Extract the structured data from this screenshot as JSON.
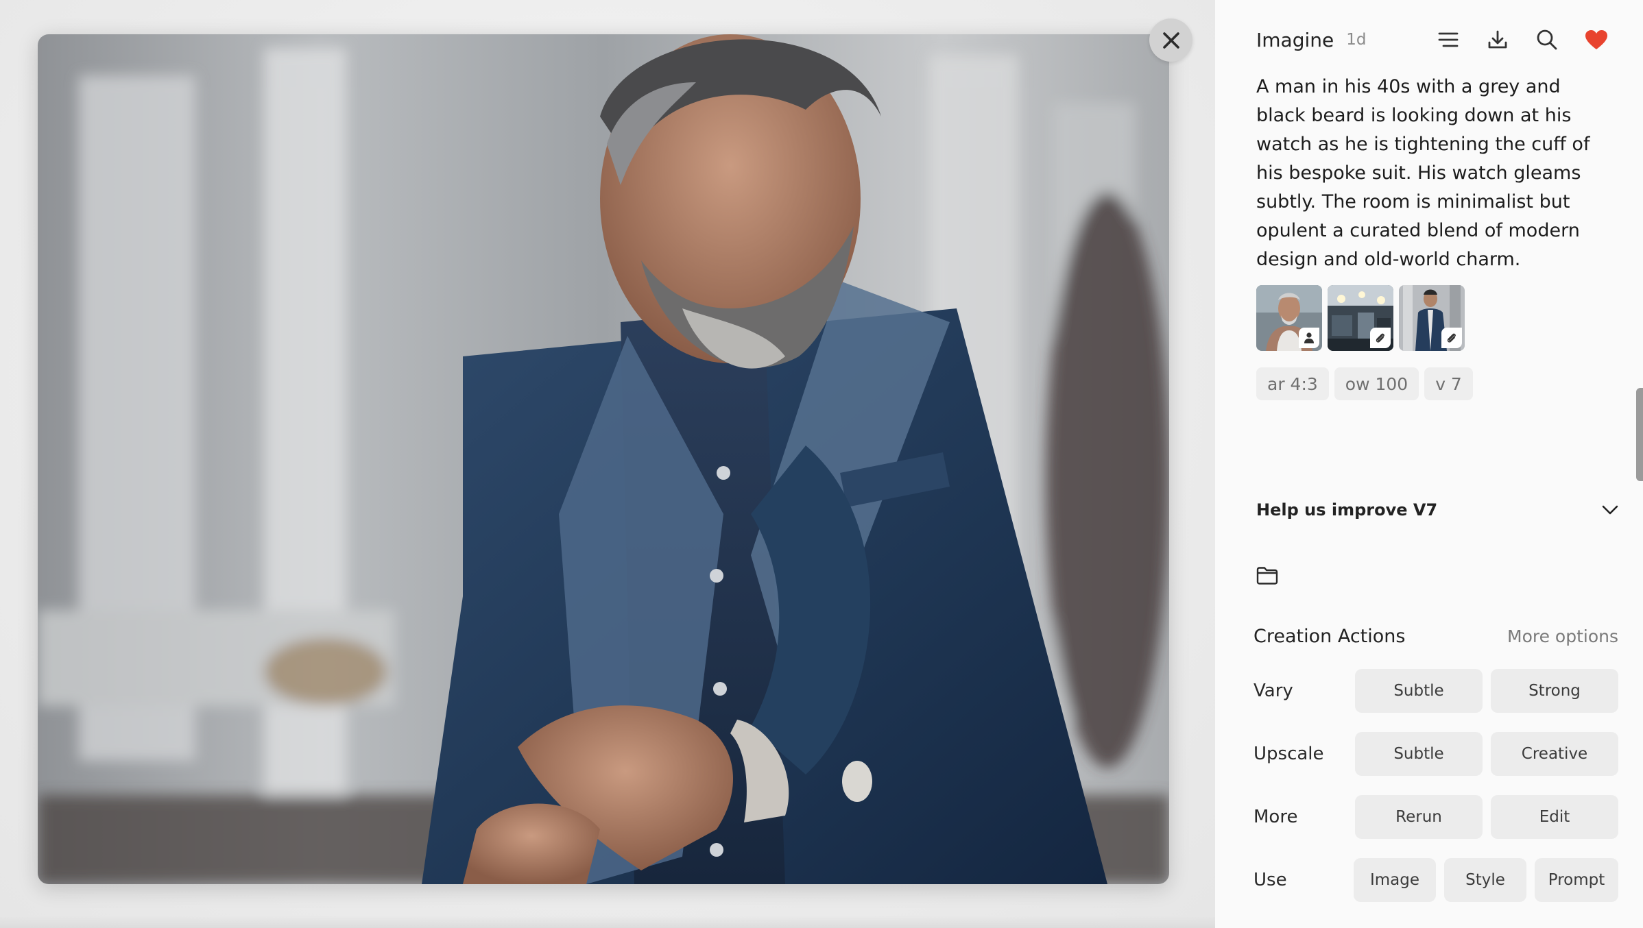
{
  "header": {
    "title": "Imagine",
    "age": "1d",
    "icons": [
      "menu-icon",
      "download-icon",
      "search-icon",
      "heart-icon"
    ],
    "heart_color": "#e8432e"
  },
  "prompt": "A man in his 40s with a grey and black beard is looking down at his watch as he is tightening the cuff of his bespoke suit. His watch gleams subtly. The room is minimalist but opulent a curated blend of modern design and old-world charm.",
  "references": [
    {
      "kind": "character-reference",
      "badge": "person-icon"
    },
    {
      "kind": "image-reference",
      "badge": "paperclip-icon"
    },
    {
      "kind": "image-reference",
      "badge": "paperclip-icon"
    }
  ],
  "params": [
    "ar 4:3",
    "ow 100",
    "v 7"
  ],
  "feedback": {
    "label": "Help us improve V7"
  },
  "actions": {
    "title": "Creation Actions",
    "more_options": "More options",
    "rows": [
      {
        "label": "Vary",
        "buttons": [
          "Subtle",
          "Strong"
        ]
      },
      {
        "label": "Upscale",
        "buttons": [
          "Subtle",
          "Creative"
        ]
      },
      {
        "label": "More",
        "buttons": [
          "Rerun",
          "Edit"
        ]
      },
      {
        "label": "Use",
        "buttons": [
          "Image",
          "Style",
          "Prompt"
        ]
      }
    ]
  }
}
